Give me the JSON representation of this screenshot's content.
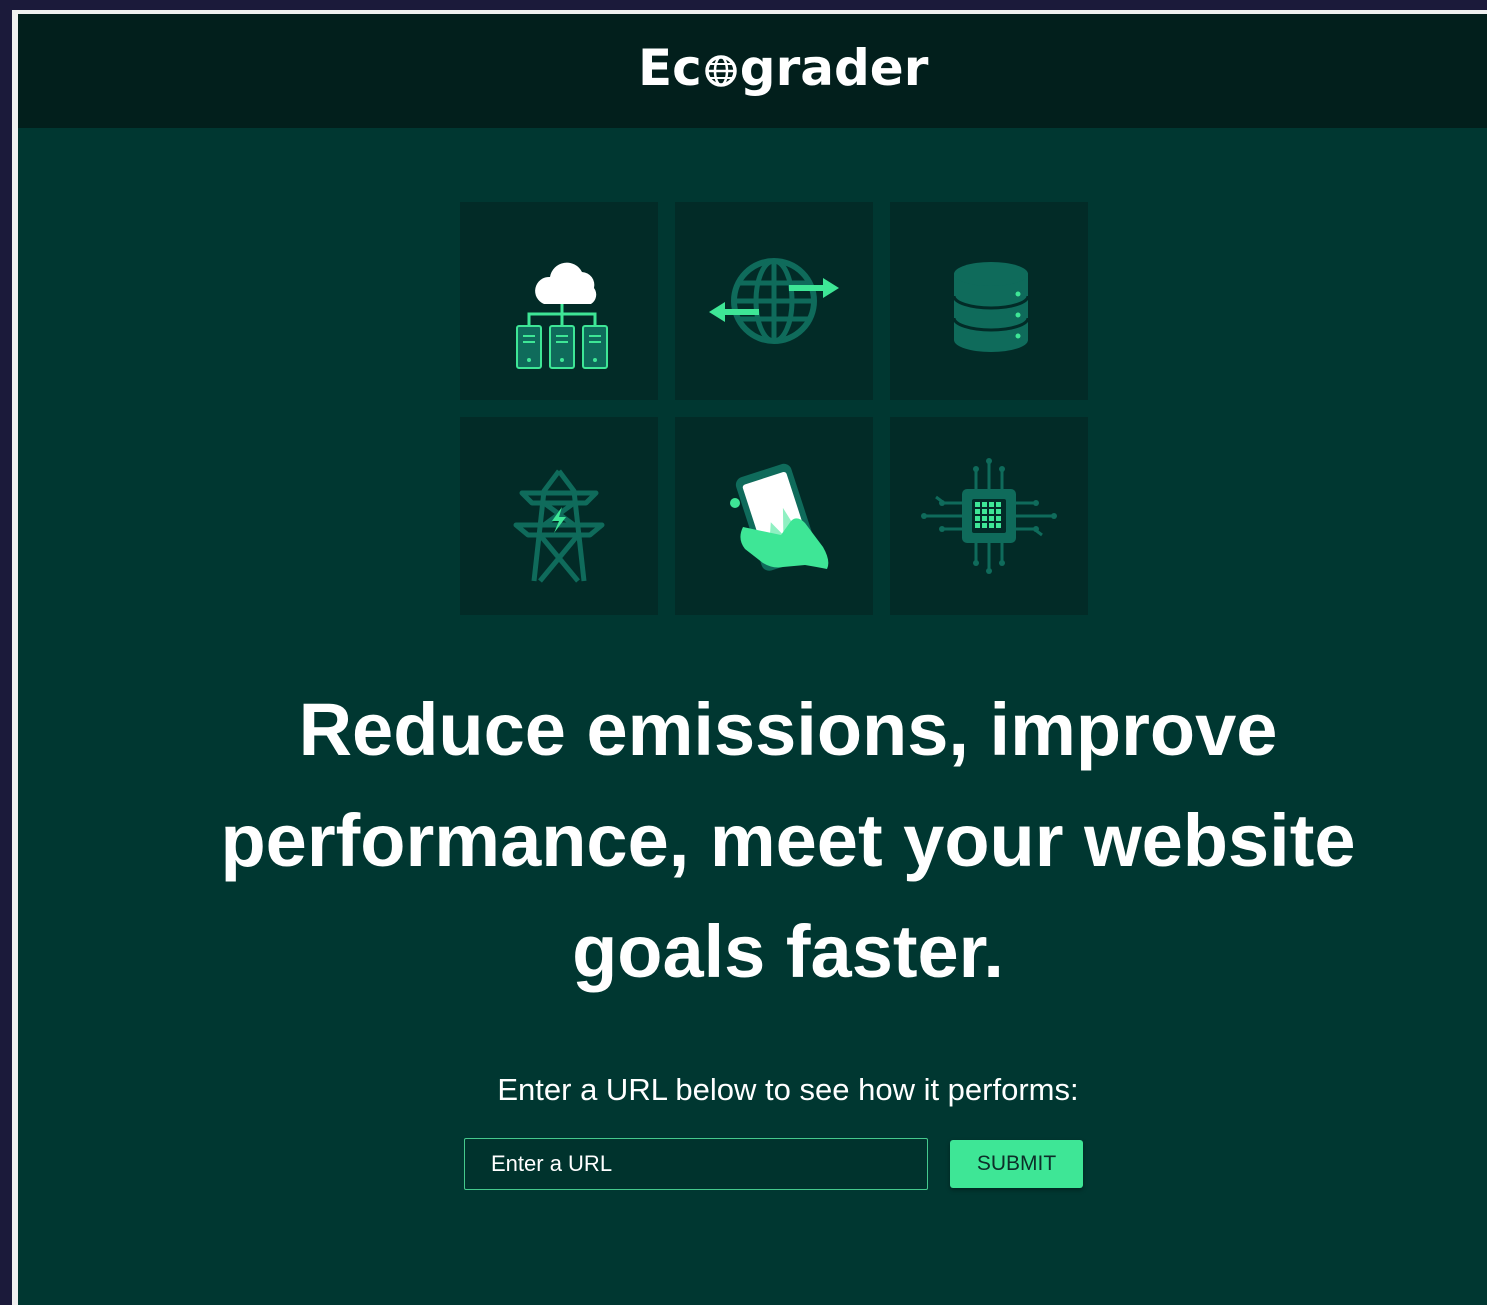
{
  "header": {
    "logo_pre": "Ec",
    "logo_post": "grader",
    "logo_icon": "globe-icon"
  },
  "tiles": [
    {
      "icon": "cloud-servers-icon"
    },
    {
      "icon": "globe-transfer-icon"
    },
    {
      "icon": "database-icon"
    },
    {
      "icon": "power-tower-icon"
    },
    {
      "icon": "phone-hand-icon"
    },
    {
      "icon": "microchip-icon"
    }
  ],
  "hero": {
    "headline": "Reduce emissions, improve performance, meet your website goals faster.",
    "prompt": "Enter a URL below to see how it performs:"
  },
  "form": {
    "url_placeholder": "Enter a URL",
    "url_value": "",
    "submit_label": "SUBMIT"
  },
  "colors": {
    "background": "#003731",
    "header": "#021f1c",
    "tile": "#022b27",
    "accent": "#3ee696",
    "icon_dark": "#0f6b5b"
  }
}
